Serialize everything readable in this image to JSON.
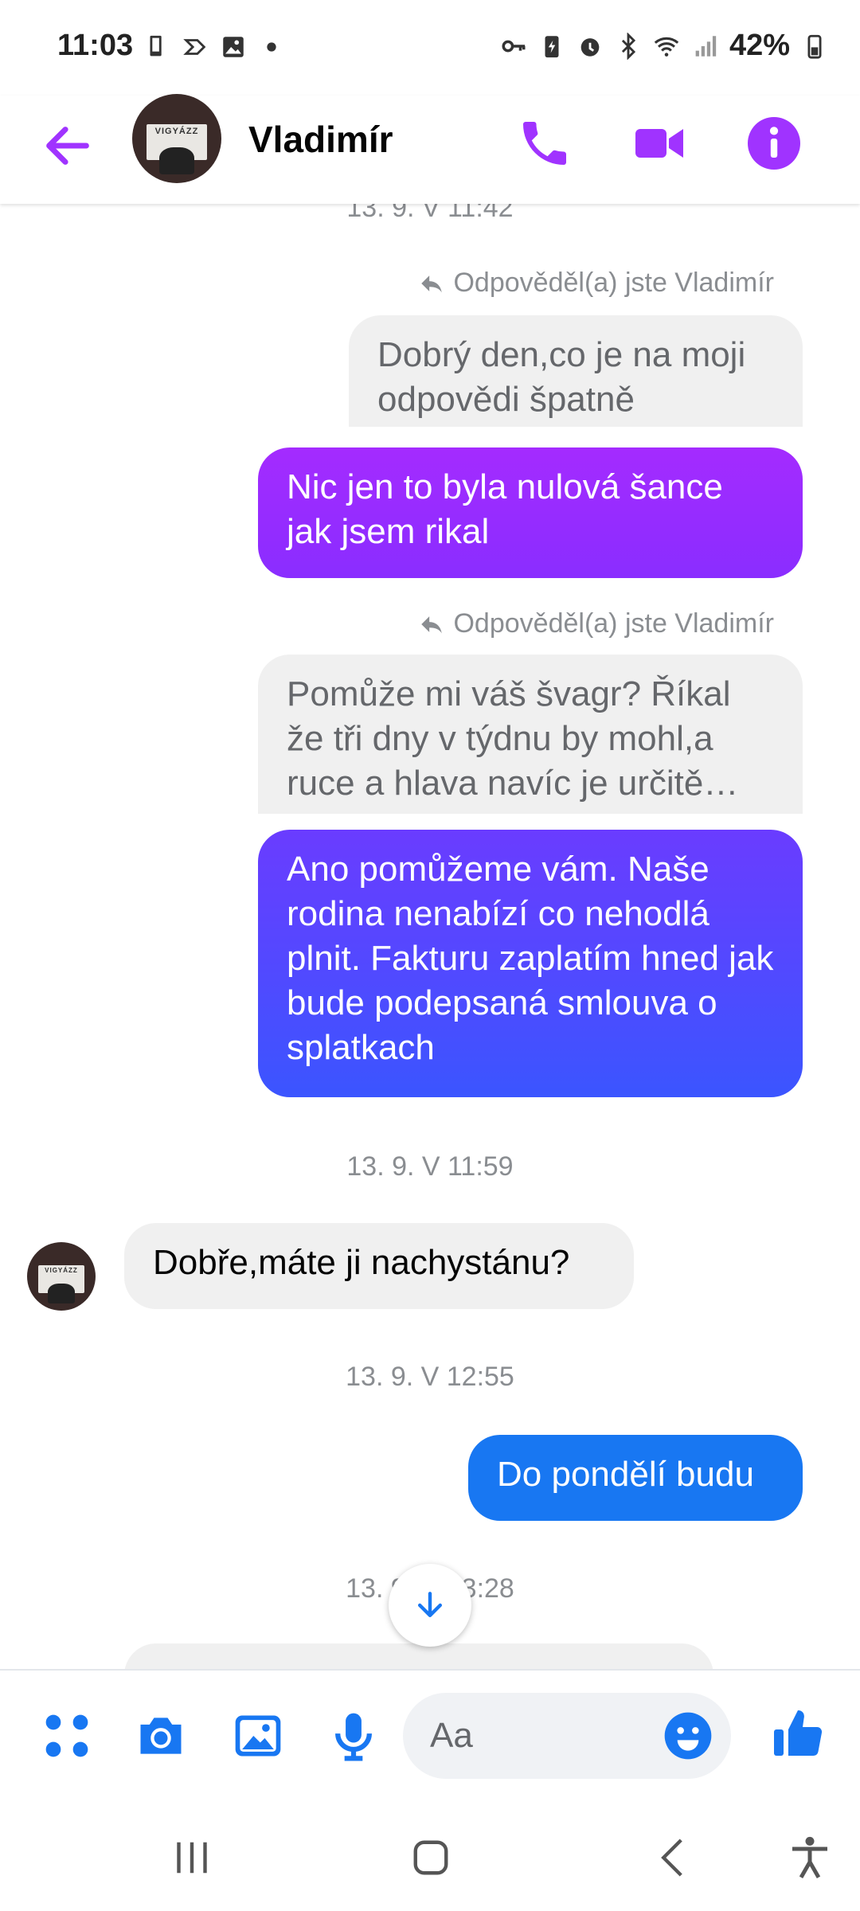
{
  "status_bar": {
    "time": "11:03",
    "battery": "42%"
  },
  "header": {
    "contact_name": "Vladimír",
    "avatar_sign_text": "VIGYÁZZ"
  },
  "chat": {
    "timestamps": [
      "13. 9. V 11:42",
      "13. 9. V 11:59",
      "13. 9. V 12:55",
      "13. 9. V 13:28"
    ],
    "reply_label": "Odpověděl(a) jste Vladimír",
    "messages": {
      "quoted_1": "Dobrý den,co je na moji odpovědi špatně",
      "out_1": "Nic jen to byla nulová šance jak jsem rikal",
      "quoted_2": "Pomůže mi váš švagr? Říkal že tři dny v týdnu by mohl,a ruce a hlava navíc je určitě…",
      "out_2": "Ano pomůžeme vám. Naše rodina nenabízí co nehodlá plnit. Fakturu zaplatím hned jak bude podepsaná smlouva o splatkach",
      "in_1": "Dobře,máte ji nachystánu?",
      "out_3": "Do pondělí budu"
    }
  },
  "composer": {
    "placeholder": "Aa"
  },
  "colors": {
    "accent": "#a033ff",
    "bubble_purple_top": "#a42bff",
    "bubble_purple_bottom": "#8a2dff",
    "bubble_blue_top": "#6a3cff",
    "bubble_blue_bottom": "#3b55ff",
    "bubble_blue": "#1877f2",
    "icon_blue": "#1877f2"
  }
}
